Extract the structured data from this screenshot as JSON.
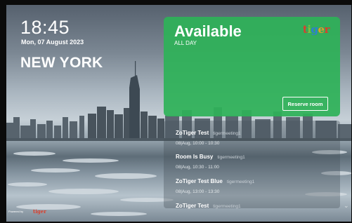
{
  "clock": {
    "time": "18:45",
    "date": "Mon, 07 August 2023"
  },
  "location": {
    "city": "NEW YORK"
  },
  "status": {
    "title": "Available",
    "subtitle": "ALL DAY",
    "reserve_label": "Reserve room",
    "color": "#2eb258"
  },
  "brand": {
    "logo_letters": [
      "t",
      "i",
      "g",
      "e",
      "r"
    ],
    "logo_colors": [
      "#d8402e",
      "#7fbf3f",
      "#2f7fd0",
      "#e39b2a",
      "#d8402e"
    ]
  },
  "meetings": [
    {
      "title": "ZoTiger Test",
      "organizer": "tigermeeting1",
      "time": "08|Aug, 10:00 - 10:30"
    },
    {
      "title": "Room Is Busy",
      "organizer": "tigermeeting1",
      "time": "08|Aug, 10:30 - 11:00"
    },
    {
      "title": "ZoTiger Test Blue",
      "organizer": "tigermeeting1",
      "time": "08|Aug, 13:00 - 13:30"
    },
    {
      "title": "ZoTiger Test",
      "organizer": "tigermeeting1",
      "time": ""
    }
  ],
  "footer": {
    "powered_by": "Powered by",
    "logo": "tiger"
  }
}
